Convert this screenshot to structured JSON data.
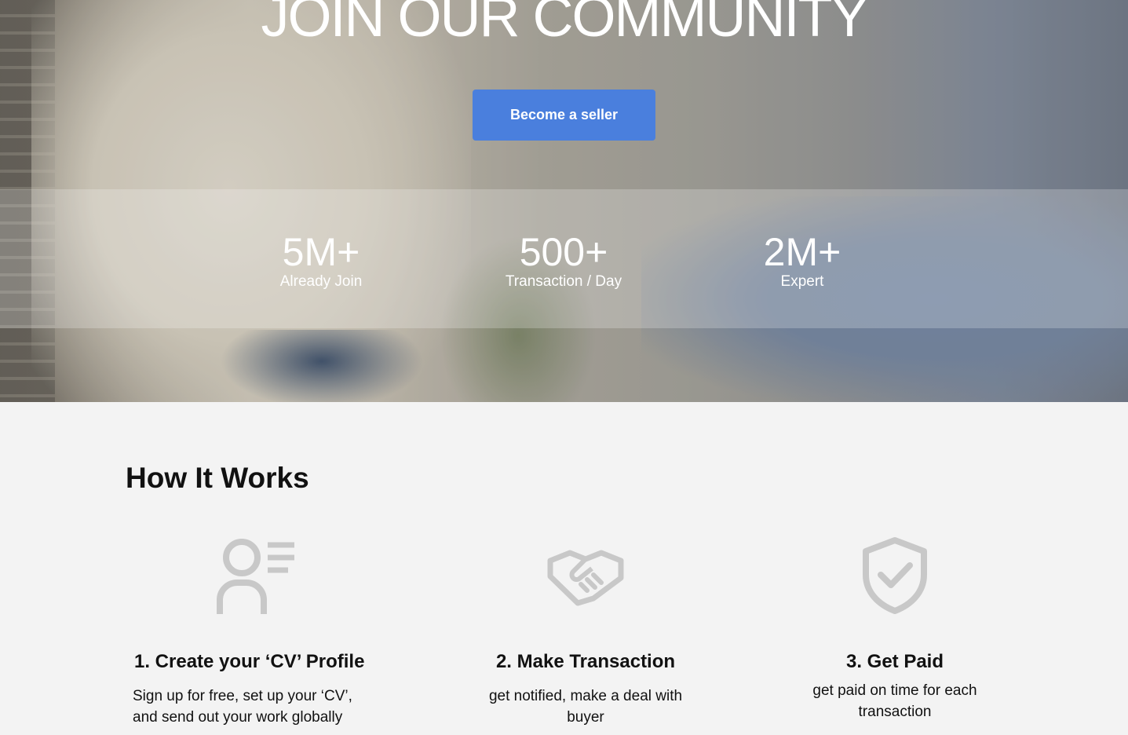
{
  "hero": {
    "title": "JOIN OUR COMMUNITY",
    "cta_label": "Become a seller",
    "cta_color": "#4a7fdd"
  },
  "stats": [
    {
      "value": "5M+",
      "label": "Already Join"
    },
    {
      "value": "500+",
      "label": "Transaction / Day"
    },
    {
      "value": "2M+",
      "label": "Expert"
    }
  ],
  "how_it_works": {
    "title": "How It Works",
    "icon_color": "#c8c8c8",
    "steps": [
      {
        "icon": "profile-icon",
        "title": "1. Create your ‘CV’ Profile",
        "desc_line1": "Sign up for free, set up your ‘CV’,",
        "desc_line2": "and send out your work globally"
      },
      {
        "icon": "handshake-icon",
        "title": "2. Make Transaction",
        "desc_line1": "get notified, make a deal with",
        "desc_line2": "buyer"
      },
      {
        "icon": "shield-check-icon",
        "title": "3. Get Paid",
        "desc_line1": "get paid on time for each",
        "desc_line2": "transaction"
      }
    ]
  }
}
